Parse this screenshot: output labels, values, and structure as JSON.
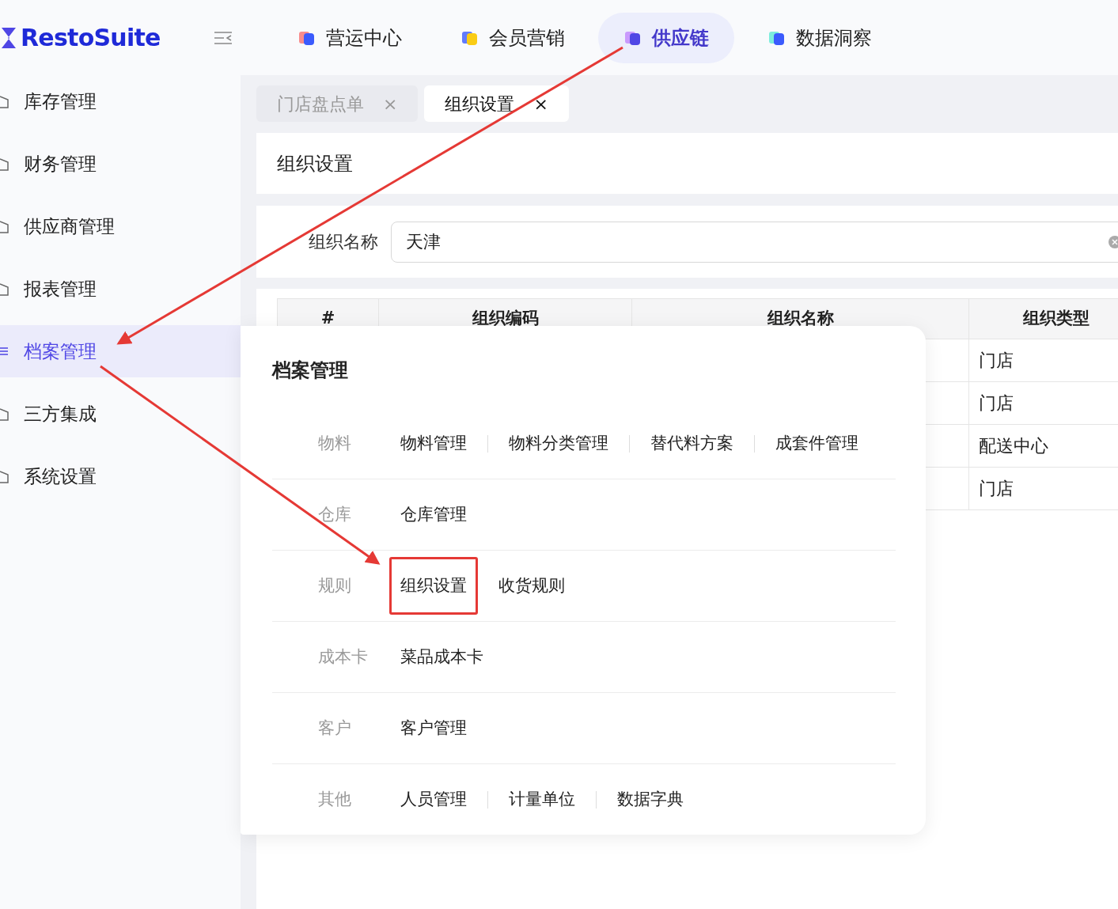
{
  "logo": "RestoSuite",
  "top_nav": [
    {
      "label": "营运中心",
      "selected": false
    },
    {
      "label": "会员营销",
      "selected": false
    },
    {
      "label": "供应链",
      "selected": true
    },
    {
      "label": "数据洞察",
      "selected": false
    }
  ],
  "sidebar": {
    "items": [
      {
        "label": "库存管理",
        "selected": false
      },
      {
        "label": "财务管理",
        "selected": false
      },
      {
        "label": "供应商管理",
        "selected": false
      },
      {
        "label": "报表管理",
        "selected": false
      },
      {
        "label": "档案管理",
        "selected": true
      },
      {
        "label": "三方集成",
        "selected": false
      },
      {
        "label": "系统设置",
        "selected": false
      }
    ]
  },
  "page_tabs": [
    {
      "label": "门店盘点单",
      "selected": false,
      "close": "×"
    },
    {
      "label": "组织设置",
      "selected": true,
      "close": "×"
    }
  ],
  "page_title": "组织设置",
  "filter": {
    "label": "组织名称",
    "value": "天津"
  },
  "table": {
    "columns": [
      "#",
      "组织编码",
      "组织名称",
      "组织类型"
    ],
    "rows": [
      {
        "type": "门店"
      },
      {
        "type": "门店"
      },
      {
        "type": "配送中心"
      },
      {
        "type": "门店"
      }
    ]
  },
  "flyout": {
    "title": "档案管理",
    "groups": [
      {
        "category": "物料",
        "items": [
          {
            "label": "物料管理",
            "highlighted": false
          },
          {
            "label": "物料分类管理",
            "highlighted": false
          },
          {
            "label": "替代料方案",
            "highlighted": false
          },
          {
            "label": "成套件管理",
            "highlighted": false
          }
        ]
      },
      {
        "category": "仓库",
        "items": [
          {
            "label": "仓库管理",
            "highlighted": false
          }
        ]
      },
      {
        "category": "规则",
        "items": [
          {
            "label": "组织设置",
            "highlighted": true
          },
          {
            "label": "收货规则",
            "highlighted": false
          }
        ]
      },
      {
        "category": "成本卡",
        "items": [
          {
            "label": "菜品成本卡",
            "highlighted": false
          }
        ]
      },
      {
        "category": "客户",
        "items": [
          {
            "label": "客户管理",
            "highlighted": false
          }
        ]
      },
      {
        "category": "其他",
        "items": [
          {
            "label": "人员管理",
            "highlighted": false
          },
          {
            "label": "计量单位",
            "highlighted": false
          },
          {
            "label": "数据字典",
            "highlighted": false
          }
        ]
      }
    ]
  }
}
